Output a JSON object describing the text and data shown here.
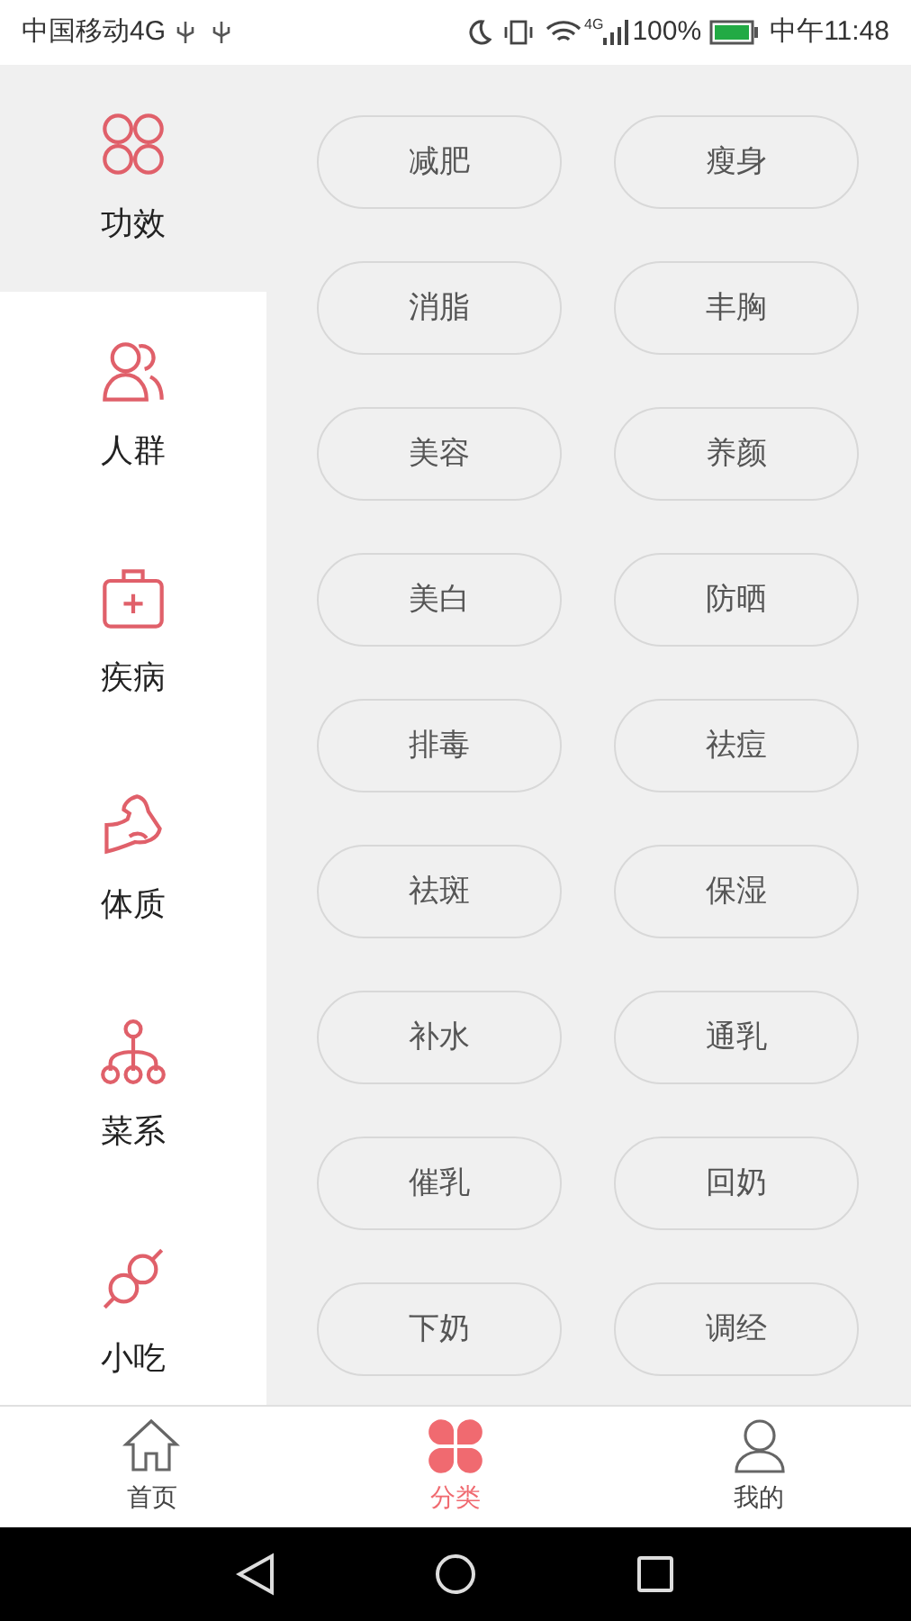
{
  "status_bar": {
    "carrier": "中国移动4G",
    "network": "4G",
    "battery": "100%",
    "time": "中午11:48"
  },
  "sidebar": {
    "items": [
      {
        "label": "功效",
        "selected": true
      },
      {
        "label": "人群",
        "selected": false
      },
      {
        "label": "疾病",
        "selected": false
      },
      {
        "label": "体质",
        "selected": false
      },
      {
        "label": "菜系",
        "selected": false
      },
      {
        "label": "小吃",
        "selected": false
      }
    ]
  },
  "tags": [
    "减肥",
    "瘦身",
    "消脂",
    "丰胸",
    "美容",
    "养颜",
    "美白",
    "防晒",
    "排毒",
    "祛痘",
    "祛斑",
    "保湿",
    "补水",
    "通乳",
    "催乳",
    "回奶",
    "下奶",
    "调经"
  ],
  "bottom_nav": [
    {
      "label": "首页",
      "selected": false
    },
    {
      "label": "分类",
      "selected": true
    },
    {
      "label": "我的",
      "selected": false
    }
  ]
}
